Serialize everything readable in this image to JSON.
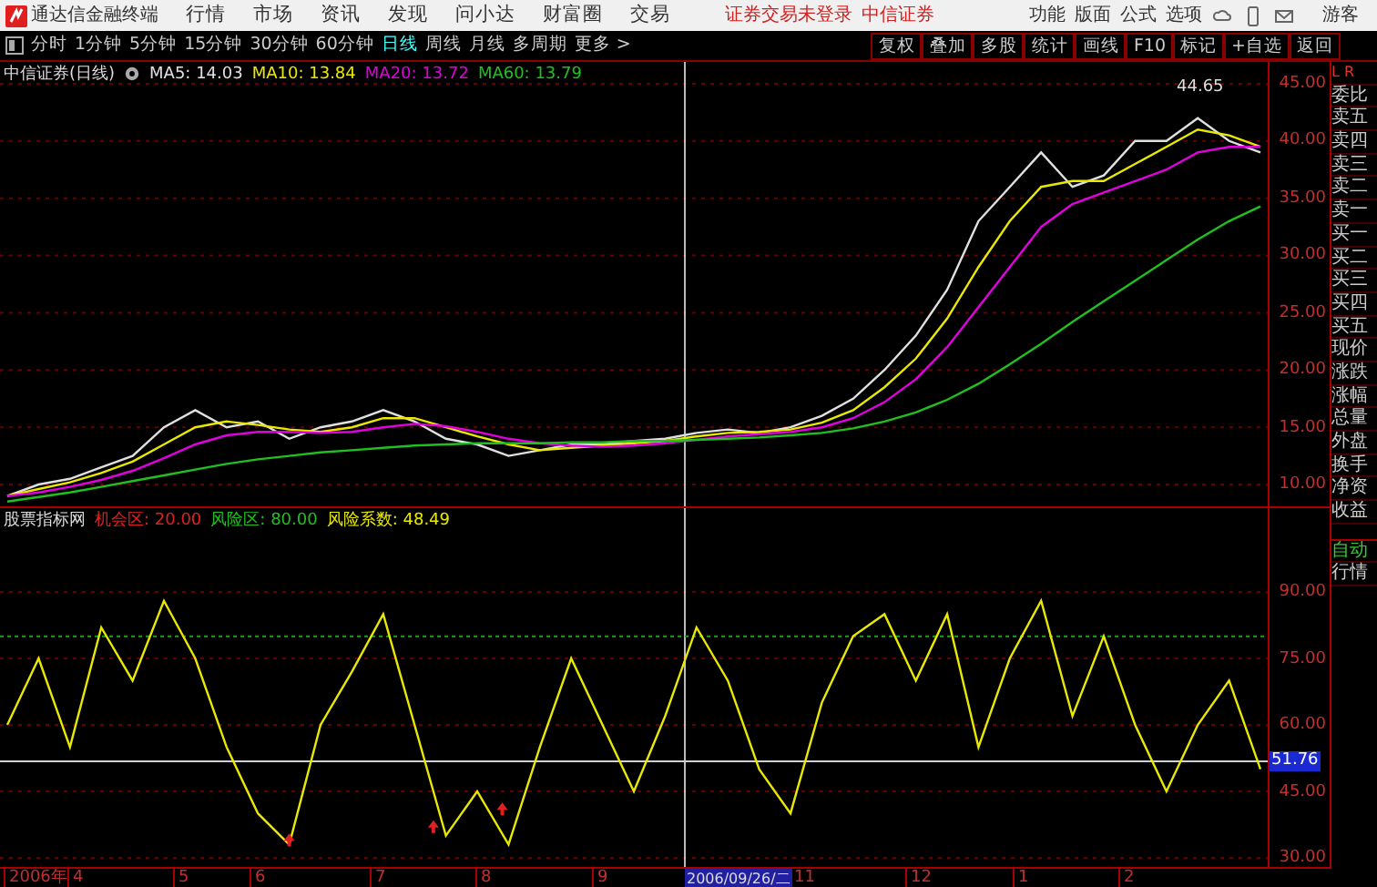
{
  "menubar": {
    "app_title": "通达信金融终端",
    "menus": [
      "行情",
      "市场",
      "资讯",
      "发现",
      "问小达",
      "财富圈",
      "交易"
    ],
    "login_status": "证券交易未登录",
    "broker": "中信证券",
    "tools": [
      "功能",
      "版面",
      "公式",
      "选项"
    ],
    "user": "游客"
  },
  "toolbar": {
    "periods": [
      {
        "label": "分时",
        "selected": false
      },
      {
        "label": "1分钟",
        "selected": false
      },
      {
        "label": "5分钟",
        "selected": false
      },
      {
        "label": "15分钟",
        "selected": false
      },
      {
        "label": "30分钟",
        "selected": false
      },
      {
        "label": "60分钟",
        "selected": false
      },
      {
        "label": "日线",
        "selected": true
      },
      {
        "label": "周线",
        "selected": false
      },
      {
        "label": "月线",
        "selected": false
      },
      {
        "label": "多周期",
        "selected": false
      },
      {
        "label": "更多 >",
        "selected": false
      }
    ],
    "actions": [
      "复权",
      "叠加",
      "多股",
      "统计",
      "画线",
      "F10",
      "标记",
      "+自选",
      "返回"
    ]
  },
  "price_panel": {
    "title": "中信证券(日线)",
    "legend": [
      {
        "label": "MA5: 14.03",
        "color": "#e0e0e0"
      },
      {
        "label": "MA10: 13.84",
        "color": "#e8e800"
      },
      {
        "label": "MA20: 13.72",
        "color": "#e000e0"
      },
      {
        "label": "MA60: 13.79",
        "color": "#20c020"
      }
    ],
    "peak_label": "44.65",
    "axis_labels": [
      "45.00",
      "40.00",
      "35.00",
      "30.00",
      "25.00",
      "20.00",
      "15.00",
      "10.00"
    ]
  },
  "indicator_panel": {
    "title": "股票指标网",
    "legend": [
      {
        "label": "机会区: 20.00",
        "color": "#e02020"
      },
      {
        "label": "风险区: 80.00",
        "color": "#20c020"
      },
      {
        "label": "风险系数: 48.49",
        "color": "#e8e800"
      }
    ],
    "current_value": "51.76",
    "axis_labels": [
      "90.00",
      "75.00",
      "60.00",
      "45.00",
      "30.00"
    ]
  },
  "time_axis": [
    "2006年",
    "4",
    "5",
    "6",
    "7",
    "8",
    "9",
    "11",
    "12",
    "1",
    "2"
  ],
  "crosshair_date": "2006/09/26/二",
  "side_panel": {
    "header": [
      "L",
      "R"
    ],
    "quote_fields": [
      "委比",
      "卖五",
      "卖四",
      "卖三",
      "卖二",
      "卖一",
      "买一",
      "买二",
      "买三",
      "买四",
      "买五",
      "现价",
      "涨跌",
      "涨幅",
      "总量",
      "外盘",
      "换手",
      "净资",
      "收益"
    ],
    "buttons": [
      "自动",
      "行情"
    ]
  }
}
